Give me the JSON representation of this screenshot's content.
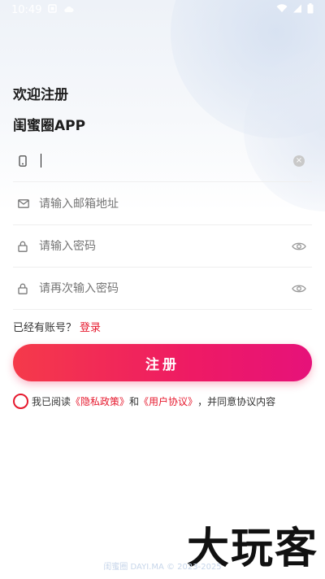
{
  "status_bar": {
    "time": "10:49",
    "icons": [
      "notification-icon",
      "cloud-icon",
      "wifi-icon",
      "signal-icon",
      "battery-icon"
    ]
  },
  "header": {
    "welcome": "欢迎注册",
    "app_name": "闺蜜圈APP"
  },
  "form": {
    "phone": {
      "value": "",
      "icon": "phone-icon"
    },
    "email": {
      "placeholder": "请输入邮箱地址",
      "icon": "mail-icon"
    },
    "password": {
      "placeholder": "请输入密码",
      "icon": "lock-icon",
      "toggle_icon": "eye-icon"
    },
    "confirm_password": {
      "placeholder": "请再次输入密码",
      "icon": "lock-icon",
      "toggle_icon": "eye-icon"
    }
  },
  "login_prompt": {
    "text": "已经有账号？",
    "link": "登录"
  },
  "register_button": "注册",
  "agreement": {
    "prefix": "我已阅读",
    "privacy": "《隐私政策》",
    "and": "和",
    "terms": "《用户协议》",
    "suffix": "，并同意协议内容"
  },
  "footer": "闺蜜圈 DAYI.MA © 2023-2025",
  "watermark": "大玩客",
  "colors": {
    "accent": "#e6182d",
    "button_start": "#f53a4a",
    "button_end": "#e6127a"
  }
}
